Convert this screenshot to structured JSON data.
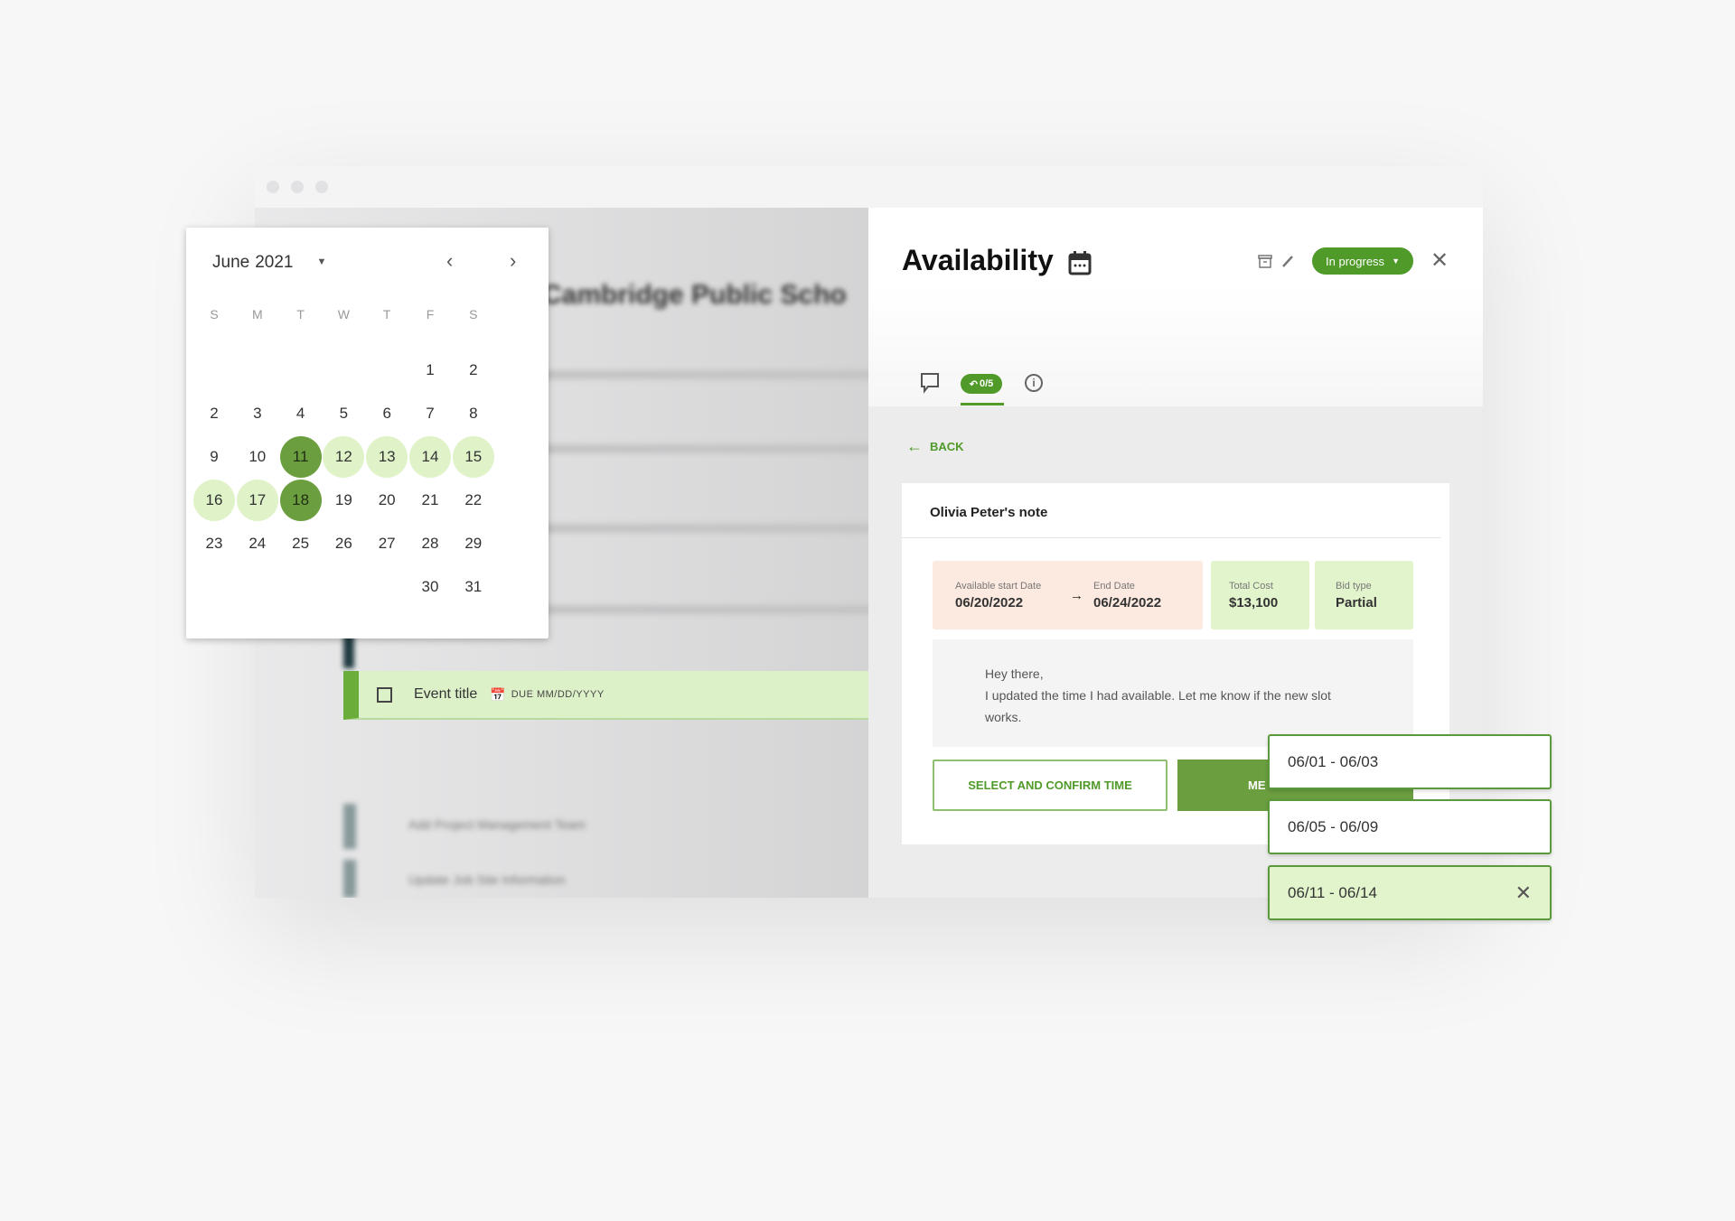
{
  "background_app": {
    "heading": "Cambridge Public Scho",
    "event_row": {
      "title": "Event title",
      "due": "DUE MM/DD/YYYY"
    },
    "list_items": [
      "Add Project Management Team",
      "Update Job Site Information"
    ]
  },
  "panel": {
    "title": "Availability",
    "status": "In progress",
    "tab_badge": "0/5",
    "back_label": "BACK",
    "note_title": "Olivia Peter's note",
    "start_label": "Available start Date",
    "start_value": "06/20/2022",
    "end_label": "End Date",
    "end_value": "06/24/2022",
    "cost_label": "Total Cost",
    "cost_value": "$13,100",
    "bid_label": "Bid type",
    "bid_value": "Partial",
    "message_line1": "Hey there,",
    "message_line2": "I updated the time I had available. Let me know if the new slot works.",
    "select_button": "SELECT AND CONFIRM TIME",
    "primary_button": "ME"
  },
  "date_ranges": [
    "06/01 - 06/03",
    "06/05 - 06/09",
    "06/11 - 06/14"
  ],
  "calendar": {
    "month_label": "June",
    "year_label": "2021",
    "weekdays": [
      "S",
      "M",
      "T",
      "W",
      "T",
      "F",
      "S"
    ],
    "weeks": [
      [
        null,
        null,
        null,
        null,
        null,
        "1",
        "2"
      ],
      [
        "2",
        "3",
        "4",
        "5",
        "6",
        "7",
        "8"
      ],
      [
        "9",
        "10",
        "11",
        "12",
        "13",
        "14",
        "15"
      ],
      [
        "16",
        "17",
        "18",
        "19",
        "20",
        "21",
        "22"
      ],
      [
        "23",
        "24",
        "25",
        "26",
        "27",
        "28",
        "29"
      ],
      [
        null,
        null,
        null,
        null,
        null,
        "30",
        "31"
      ]
    ],
    "selected_endpoints": [
      "11",
      "18"
    ],
    "in_range": [
      "12",
      "13",
      "14",
      "15",
      "16",
      "17"
    ]
  },
  "colors": {
    "accent": "#4f9a28",
    "selected": "#6a9e3f",
    "range": "#dff2c8",
    "peach": "#fce9df",
    "light_green": "#e2f4cc"
  }
}
